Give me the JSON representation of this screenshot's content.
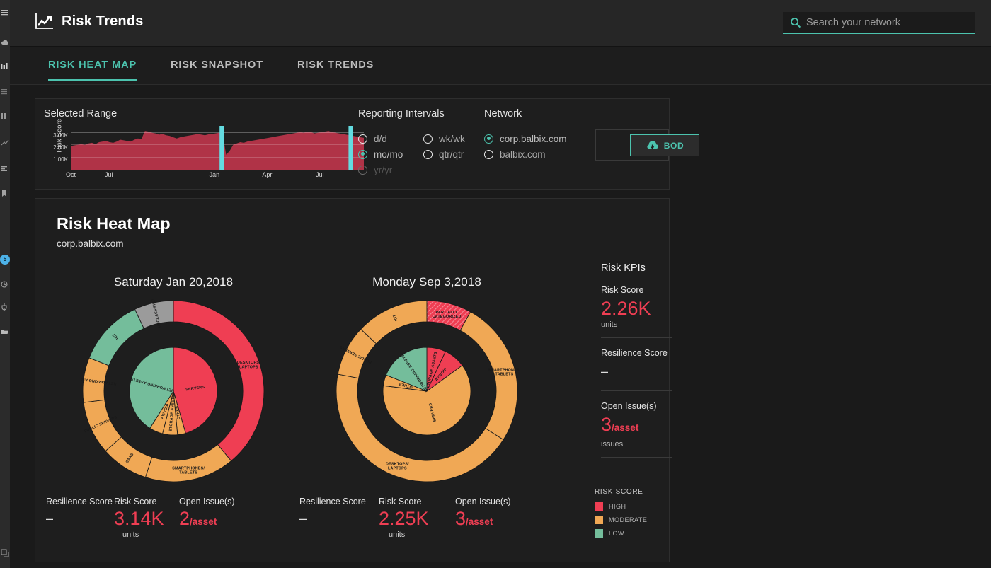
{
  "accent": "#4cc3ae",
  "colors": {
    "high": "#ef3e53",
    "moderate": "#f0a855",
    "low": "#74bd9b",
    "unclassified": "#9b9b9b",
    "panel": "#1e1e1e",
    "app_bg": "#1a1a1a"
  },
  "header": {
    "title": "Risk Trends",
    "icon": "trend-chart-icon",
    "search": {
      "placeholder": "Search your network",
      "value": "",
      "icon": "search-icon"
    }
  },
  "tabs": [
    {
      "label": "RISK HEAT MAP",
      "active": true
    },
    {
      "label": "RISK SNAPSHOT",
      "active": false
    },
    {
      "label": "RISK TRENDS",
      "active": false
    }
  ],
  "range_panel": {
    "label": "Selected Range",
    "chart": {
      "ylabel": "Risk Score",
      "yticks": [
        "3.00K",
        "2.00K",
        "1.00K"
      ],
      "xticks": [
        "Jul",
        "Oct",
        "Jan",
        "Apr",
        "Jul"
      ],
      "handle_color": "#63dbe0",
      "area_color": "#b03347",
      "selection": {
        "start_pct": 51.5,
        "end_pct": 95.5
      }
    },
    "reporting_intervals": {
      "label": "Reporting Intervals",
      "options": [
        {
          "label": "d/d",
          "selected": false,
          "disabled": false
        },
        {
          "label": "wk/wk",
          "selected": false,
          "disabled": false
        },
        {
          "label": "mo/mo",
          "selected": true,
          "disabled": false
        },
        {
          "label": "qtr/qtr",
          "selected": false,
          "disabled": false
        },
        {
          "label": "yr/yr",
          "selected": false,
          "disabled": true
        }
      ]
    },
    "network": {
      "label": "Network",
      "options": [
        {
          "label": "corp.balbix.com",
          "selected": true
        },
        {
          "label": "balbix.com",
          "selected": false
        }
      ]
    },
    "bod_button": {
      "label": "BOD",
      "icon": "cloud-download-icon"
    }
  },
  "heat_panel": {
    "title": "Risk Heat Map",
    "subtitle": "corp.balbix.com",
    "charts": [
      {
        "date": "Saturday Jan 20,2018",
        "stats": [
          {
            "label": "Resilience Score",
            "value": "–",
            "suffix": "",
            "sub": ""
          },
          {
            "label": "Risk Score",
            "value": "3.14K",
            "suffix": "",
            "sub": "units"
          },
          {
            "label": "Open Issue(s)",
            "value": "2",
            "suffix": "/asset",
            "sub": ""
          }
        ]
      },
      {
        "date": "Monday Sep 3,2018",
        "stats": [
          {
            "label": "Resilience Score",
            "value": "–",
            "suffix": "",
            "sub": ""
          },
          {
            "label": "Risk Score",
            "value": "2.25K",
            "suffix": "",
            "sub": "units"
          },
          {
            "label": "Open Issue(s)",
            "value": "3",
            "suffix": "/asset",
            "sub": ""
          }
        ]
      }
    ],
    "kpis": {
      "title": "Risk KPIs",
      "items": [
        {
          "label": "Risk Score",
          "value": "2.26K",
          "suffix": "",
          "sub": "units"
        },
        {
          "label": "Resilience Score",
          "value": "–",
          "suffix": "",
          "sub": ""
        },
        {
          "label": "Open Issue(s)",
          "value": "3",
          "suffix": "/asset",
          "sub": "issues"
        }
      ]
    },
    "legend": {
      "title": "RISK SCORE",
      "items": [
        {
          "label": "HIGH",
          "color": "#ef3e53"
        },
        {
          "label": "MODERATE",
          "color": "#f0a855"
        },
        {
          "label": "LOW",
          "color": "#74bd9b"
        }
      ]
    }
  },
  "sidebar": {
    "items": [
      {
        "name": "menu-icon",
        "y": 12
      },
      {
        "name": "cloud-icon",
        "y": 58
      },
      {
        "name": "bar-chart-icon",
        "y": 88
      },
      {
        "name": "list-icon",
        "y": 124
      },
      {
        "name": "grid-icon",
        "y": 158
      },
      {
        "name": "trend-up-icon",
        "y": 196
      },
      {
        "name": "layers-icon",
        "y": 232
      },
      {
        "name": "bookmark-icon",
        "y": 268
      },
      {
        "name": "notification-badge",
        "y": 360,
        "badge": "5"
      },
      {
        "name": "clock-icon",
        "y": 396
      },
      {
        "name": "plug-icon",
        "y": 428
      },
      {
        "name": "folder-icon",
        "y": 462
      },
      {
        "name": "expand-icon",
        "y": 776
      }
    ]
  },
  "chart_data": [
    {
      "type": "pie",
      "title": "Saturday Jan 20,2018",
      "legend": "inner",
      "inner_ring": {
        "name": "Asset Categories (inner)",
        "segments": [
          {
            "label": "SERVERS",
            "value": 45.5,
            "risk": "high",
            "color": "#ef3e53"
          },
          {
            "label": "OTHER",
            "value": 3.0,
            "risk": "moderate",
            "color": "#f0a855"
          },
          {
            "label": "STORAGE ASSETS",
            "value": 5.5,
            "risk": "moderate",
            "color": "#f0a855"
          },
          {
            "label": "AV/VOIP",
            "value": 5.0,
            "risk": "moderate",
            "color": "#f0a855"
          },
          {
            "label": "NETWORKING ASSETS",
            "value": 41.0,
            "risk": "low",
            "color": "#74bd9b"
          }
        ]
      },
      "outer_ring": {
        "name": "Asset Types (outer)",
        "segments": [
          {
            "label": "DESKTOPS/ LAPTOPS",
            "value": 39.0,
            "risk": "high",
            "color": "#ef3e53"
          },
          {
            "label": "SMARTPHONES/ TABLETS",
            "value": 16.0,
            "risk": "moderate",
            "color": "#f0a855"
          },
          {
            "label": "SAAS",
            "value": 8.5,
            "risk": "moderate",
            "color": "#f0a855"
          },
          {
            "label": "PUBLIC SERVERS",
            "value": 9.5,
            "risk": "moderate",
            "color": "#f0a855"
          },
          {
            "label": "NETWORKING ASSETS",
            "value": 8.0,
            "risk": "moderate",
            "color": "#f0a855"
          },
          {
            "label": "IOT",
            "value": 12.0,
            "risk": "low",
            "color": "#74bd9b"
          },
          {
            "label": "UNCLASSIFIED",
            "value": 7.0,
            "risk": "unclassified",
            "color": "#9b9b9b"
          }
        ]
      }
    },
    {
      "type": "pie",
      "title": "Monday Sep 3,2018",
      "legend": "inner",
      "inner_ring": {
        "name": "Asset Categories (inner)",
        "segments": [
          {
            "label": "STORAGE ASSETS",
            "value": 7.0,
            "risk": "high",
            "color": "#ef3e53"
          },
          {
            "label": "AV/VOIP",
            "value": 8.0,
            "risk": "high",
            "color": "#ef3e53"
          },
          {
            "label": "SERVERS",
            "value": 62.0,
            "risk": "moderate",
            "color": "#f0a855"
          },
          {
            "label": "OTHER",
            "value": 4.0,
            "risk": "moderate",
            "color": "#f0a855"
          },
          {
            "label": "NETWORKING ASSETS",
            "value": 19.0,
            "risk": "low",
            "color": "#74bd9b"
          }
        ]
      },
      "outer_ring": {
        "name": "Asset Types (outer)",
        "segments": [
          {
            "label": "PARTIALLY CATEGORIZED",
            "value": 8.0,
            "risk": "high",
            "color": "#ef3e53",
            "hatched": true
          },
          {
            "label": "SMARTPHONES/ TABLETS",
            "value": 26.0,
            "risk": "moderate",
            "color": "#f0a855"
          },
          {
            "label": "DESKTOPS/ LAPTOPS",
            "value": 44.0,
            "risk": "moderate",
            "color": "#f0a855"
          },
          {
            "label": "PUBLIC SERVERS",
            "value": 9.0,
            "risk": "moderate",
            "color": "#f0a855"
          },
          {
            "label": "IOT",
            "value": 13.0,
            "risk": "moderate",
            "color": "#f0a855"
          }
        ]
      }
    },
    {
      "type": "area",
      "title": "Selected Range",
      "ylabel": "Risk Score",
      "ylim": [
        0,
        3500
      ],
      "yticks": [
        1000,
        2000,
        3000
      ],
      "xticks": [
        "Jul",
        "Oct",
        "Jan",
        "Apr",
        "Jul"
      ],
      "grid": true,
      "values": [
        1900,
        1950,
        2000,
        2050,
        1980,
        2100,
        2150,
        2050,
        2200,
        2250,
        2300,
        2200,
        2150,
        2250,
        2400,
        2350,
        2300,
        2250,
        2400,
        2500,
        2450,
        3100,
        3050,
        2950,
        2900,
        2800,
        2850,
        2750,
        2700,
        2600,
        2500,
        2600,
        2650,
        2700,
        2750,
        2800,
        2850,
        2800,
        2750,
        2820,
        2860,
        2900,
        2950,
        2900,
        1200,
        1500,
        2000,
        2100,
        2200,
        2150,
        2250,
        2300,
        2350,
        2400,
        2450,
        2500,
        2550,
        2600,
        2650,
        2700,
        2750,
        2800,
        2850,
        2900,
        2950,
        3000,
        2950,
        3050,
        3000,
        2900,
        2950,
        3000,
        3050,
        3100,
        3000,
        2950,
        2900,
        2850,
        2800,
        2750,
        2700,
        2650,
        2600,
        2550
      ]
    }
  ]
}
